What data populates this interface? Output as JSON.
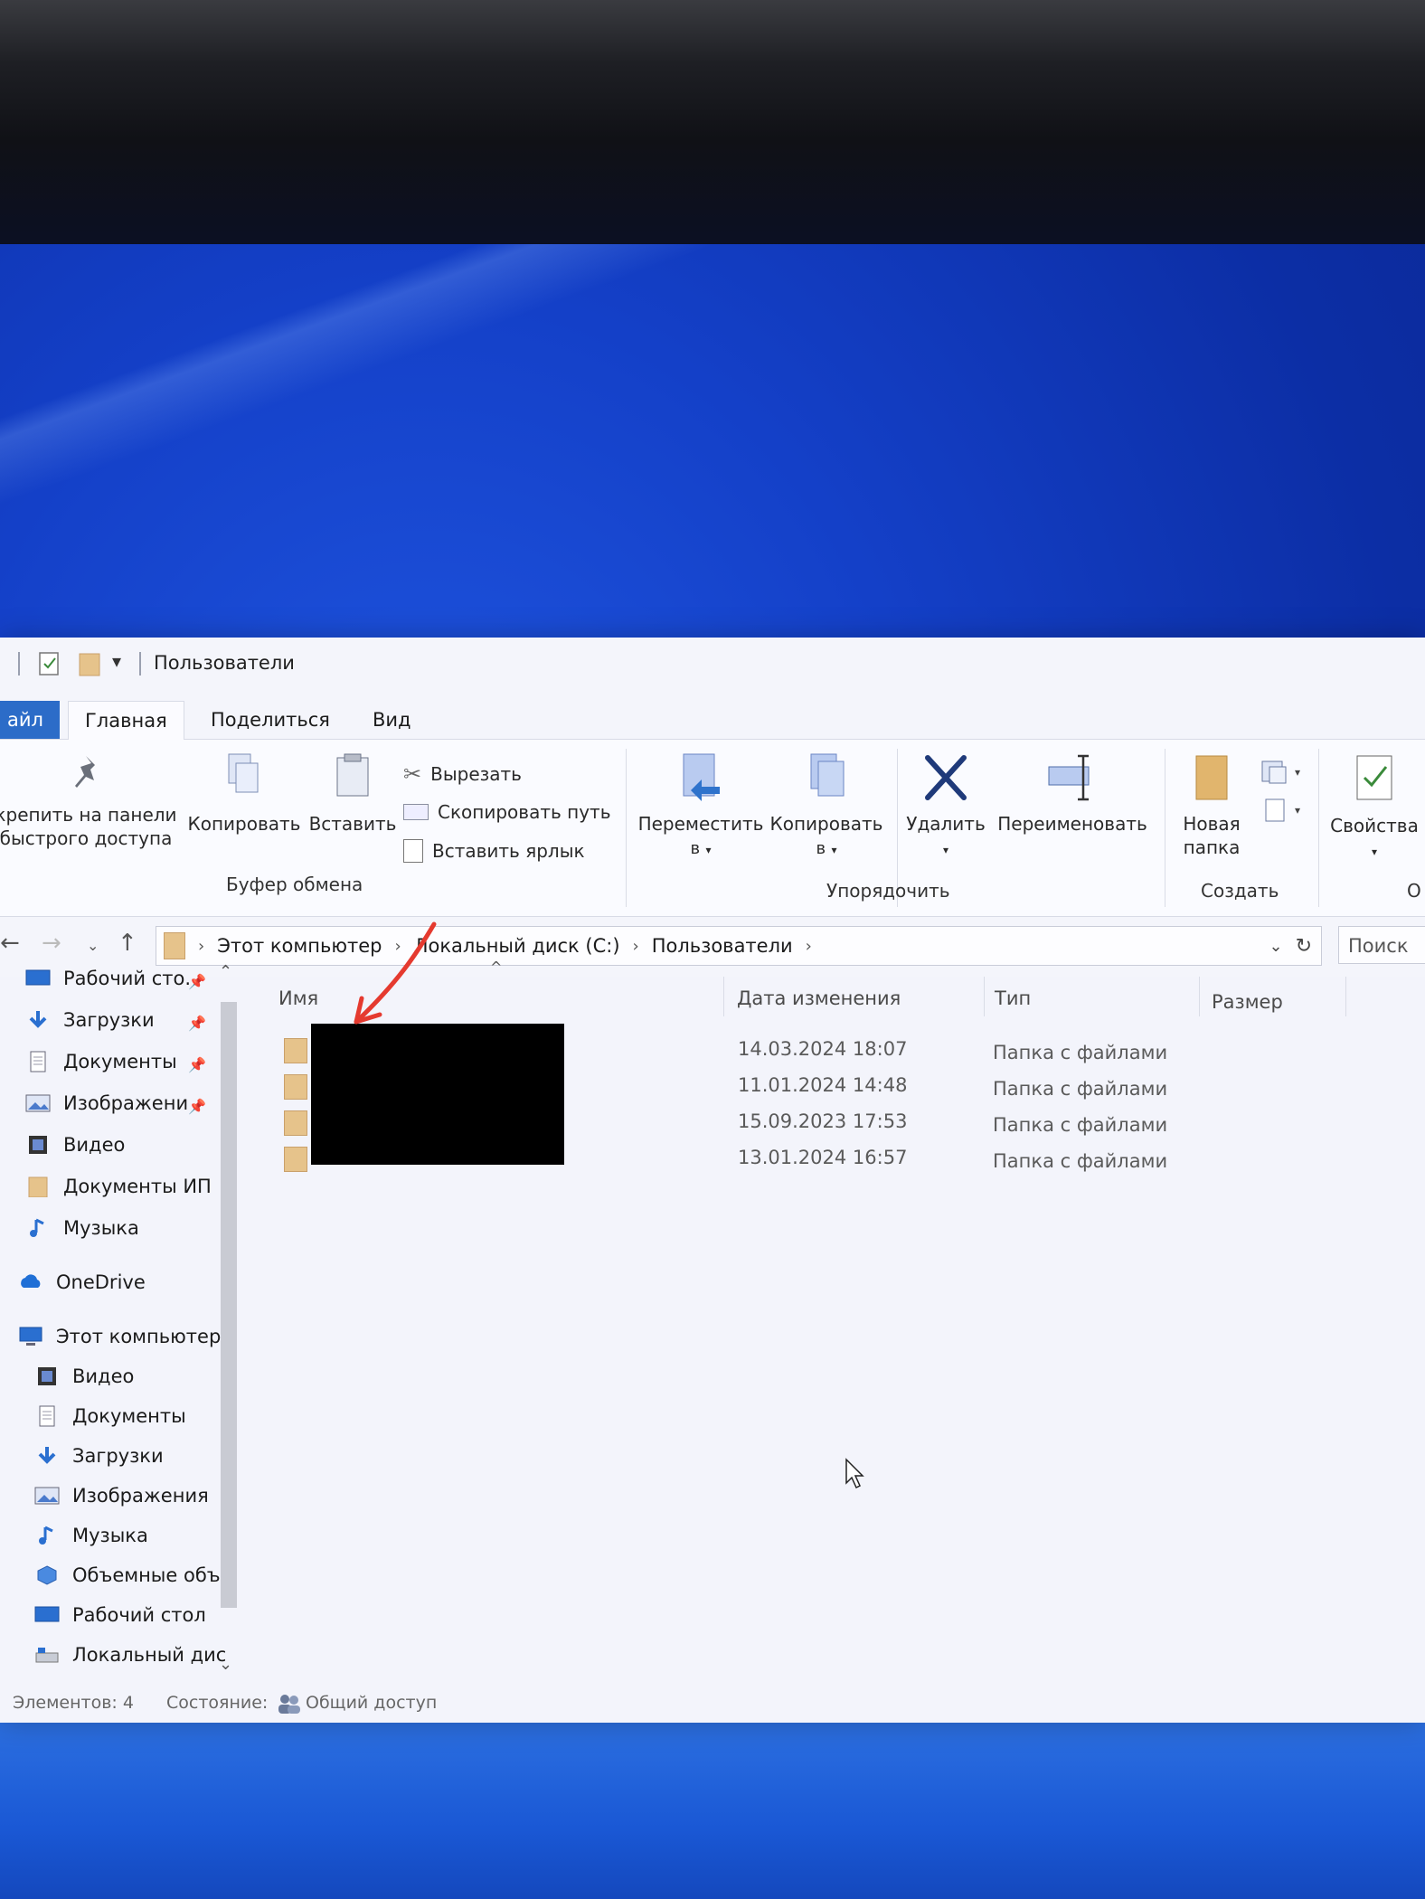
{
  "window": {
    "title": "Пользователи"
  },
  "tabs": [
    {
      "label": "айл"
    },
    {
      "label": "Главная"
    },
    {
      "label": "Поделиться"
    },
    {
      "label": "Вид"
    }
  ],
  "ribbon": {
    "pin_label_line1": "крепить на панели",
    "pin_label_line2": "быстрого доступа",
    "copy_label": "Копировать",
    "paste_label": "Вставить",
    "cut_label": "Вырезать",
    "copy_path_label": "Скопировать путь",
    "paste_shortcut_label": "Вставить ярлык",
    "clipboard_group": "Буфер обмена",
    "move_to_label_line1": "Переместить",
    "move_to_label_line2": "в",
    "copy_to_label_line1": "Копировать",
    "copy_to_label_line2": "в",
    "delete_label": "Удалить",
    "rename_label": "Переименовать",
    "organize_group": "Упорядочить",
    "new_folder_line1": "Новая",
    "new_folder_line2": "папка",
    "create_group": "Создать",
    "properties_label": "Свойства",
    "open_group_partial": "О"
  },
  "address": {
    "crumbs": [
      "Этот компьютер",
      "Локальный диск (C:)",
      "Пользователи"
    ],
    "search_placeholder": "Поиск"
  },
  "nav_pane": {
    "items": [
      {
        "label": "Рабочий сто.",
        "icon": "desktop-icon",
        "pinned": true
      },
      {
        "label": "Загрузки",
        "icon": "download-icon",
        "pinned": true
      },
      {
        "label": "Документы",
        "icon": "document-icon",
        "pinned": true
      },
      {
        "label": "Изображени",
        "icon": "image-icon",
        "pinned": true
      },
      {
        "label": "Видео",
        "icon": "video-icon",
        "pinned": false
      },
      {
        "label": "Документы ИП",
        "icon": "folder-icon",
        "pinned": false
      },
      {
        "label": "Музыка",
        "icon": "music-icon",
        "pinned": false
      },
      {
        "label": "OneDrive",
        "icon": "cloud-icon",
        "pinned": false
      },
      {
        "label": "Этот компьютер",
        "icon": "computer-icon",
        "pinned": false
      },
      {
        "label": "Видео",
        "icon": "video-icon",
        "pinned": false
      },
      {
        "label": "Документы",
        "icon": "document-icon",
        "pinned": false
      },
      {
        "label": "Загрузки",
        "icon": "download-icon",
        "pinned": false
      },
      {
        "label": "Изображения",
        "icon": "image-icon",
        "pinned": false
      },
      {
        "label": "Музыка",
        "icon": "music-icon",
        "pinned": false
      },
      {
        "label": "Объемные объ",
        "icon": "3d-objects-icon",
        "pinned": false
      },
      {
        "label": "Рабочий стол",
        "icon": "desktop-icon",
        "pinned": false
      },
      {
        "label": "Локальный дис",
        "icon": "drive-icon",
        "pinned": false
      }
    ]
  },
  "columns": {
    "name": "Имя",
    "date": "Дата изменения",
    "type": "Тип",
    "size": "Размер"
  },
  "files": [
    {
      "date": "14.03.2024 18:07",
      "type": "Папка с файлами"
    },
    {
      "date": "11.01.2024 14:48",
      "type": "Папка с файлами"
    },
    {
      "date": "15.09.2023 17:53",
      "type": "Папка с файлами"
    },
    {
      "date": "13.01.2024 16:57",
      "type": "Папка с файлами"
    }
  ],
  "status": {
    "items_count": "Элементов: 4",
    "state_label": "Состояние:",
    "state_value": "Общий доступ"
  },
  "colors": {
    "accent": "#2c6cc8",
    "desktop_blue": "#1440c8",
    "annotation_red": "#e53a2f"
  }
}
